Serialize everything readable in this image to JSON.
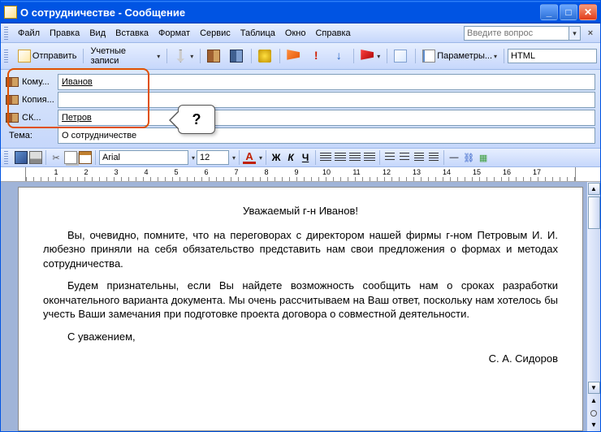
{
  "window": {
    "title": "О сотрудничестве  - Сообщение"
  },
  "menus": {
    "file": "Файл",
    "edit": "Правка",
    "view": "Вид",
    "insert": "Вставка",
    "format": "Формат",
    "service": "Сервис",
    "table": "Таблица",
    "window": "Окно",
    "help": "Справка",
    "help_search_placeholder": "Введите вопрос"
  },
  "toolbar": {
    "send": "Отправить",
    "accounts": "Учетные записи",
    "params": "Параметры...",
    "format_select": "HTML"
  },
  "recipients": {
    "to_label": "Кому...",
    "to_value": "Иванов",
    "cc_label": "Копия...",
    "cc_value": "",
    "bcc_label": "СК...",
    "bcc_value": "Петров",
    "subject_label": "Тема:",
    "subject_value": "О сотрудничестве"
  },
  "callout": {
    "text": "?"
  },
  "format_bar": {
    "font": "Arial",
    "size": "12",
    "bold": "Ж",
    "italic": "К",
    "underline": "Ч",
    "fontcolor": "A"
  },
  "ruler": {
    "numbers": [
      "1",
      "2",
      "3",
      "4",
      "5",
      "6",
      "7",
      "8",
      "9",
      "10",
      "11",
      "12",
      "13",
      "14",
      "15",
      "16",
      "17"
    ]
  },
  "body": {
    "greeting": "Уважаемый г-н Иванов!",
    "p1": "Вы, очевидно, помните, что на переговорах с директором нашей фирмы г-ном Петровым И. И. любезно приняли на себя обязательство представить нам свои предложения о формах и методах сотрудничества.",
    "p2": "Будем признательны, если Вы найдете возможность сообщить нам о сроках разработки окончательного варианта документа. Мы очень рассчитываем на Ваш ответ, поскольку нам хотелось бы учесть Ваши замечания при подготовке проекта договора о совместной деятельности.",
    "p3": "С уважением,",
    "signature": "С. А. Сидоров"
  }
}
